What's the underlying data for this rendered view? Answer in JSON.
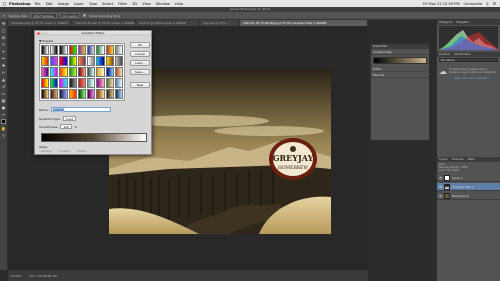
{
  "menubar": {
    "app": "Photoshop",
    "items": [
      "File",
      "Edit",
      "Image",
      "Layer",
      "Type",
      "Select",
      "Filter",
      "3D",
      "View",
      "Window",
      "Help"
    ],
    "time": "Fri May 22 12:09 PM",
    "user": "Cartophile"
  },
  "window": {
    "title": "Adobe Photoshop CC 2014"
  },
  "options": {
    "sample_label": "Sample Size:",
    "sample_value": "Point Sample",
    "layer_value": "All Layers",
    "show_ring": "Show Sampling Ring"
  },
  "doc_tabs": [
    "Yellowstone@ @ 33.3% (Layer 1, RGB/8)",
    "2014-03-15.psb @ 33.3% (Layer 1, RGB/8)",
    "Layer 5 @ 100% (Layer 2, RGB/8)",
    "logo.psd @ 33% ...",
    "2014-01-30 13.09.08.jpg @ 33.3% (Gradient Map 1, RGB/8)"
  ],
  "status": {
    "zoom": "33.33%",
    "doc": "Doc: 14.1M/28.7M"
  },
  "dialog": {
    "title": "Gradient Editor",
    "presets_label": "Presets",
    "buttons": {
      "ok": "OK",
      "cancel": "Cancel",
      "load": "Load...",
      "save": "Save...",
      "new": "New"
    },
    "name_label": "Name:",
    "name_value": "Custom",
    "type_label": "Gradient Type:",
    "type_value": "Solid",
    "smooth_label": "Smoothness:",
    "smooth_value": "100",
    "smooth_unit": "%",
    "stops_label": "Stops",
    "stops": {
      "opacity": "Opacity:",
      "location": "Location:",
      "delete": "Delete",
      "color": "Color:"
    },
    "preset_gradients": [
      [
        "#000000",
        "#ffffff"
      ],
      [
        "#ffffff",
        "#000000"
      ],
      [
        "#000000",
        "#ffffff"
      ],
      [
        "#ff0000",
        "#00ff00"
      ],
      [
        "#7a3a9a",
        "#f0c040"
      ],
      [
        "#1e3c8c",
        "#e0e0e0"
      ],
      [
        "#1f7a3a",
        "#ffffff"
      ],
      [
        "#c03030",
        "#f0e030"
      ],
      [
        "#808080",
        "#ffffff"
      ],
      [
        "#ffcc00",
        "#cc3300"
      ],
      [
        "#3355ff",
        "#ff33cc"
      ],
      [
        "#ff0000",
        "#0000ff"
      ],
      [
        "#008000",
        "#ffff00"
      ],
      [
        "#ff8c00",
        "#663399"
      ],
      [
        "#ffffff",
        "#808080"
      ],
      [
        "#00bfff",
        "#00008b"
      ],
      [
        "#ffd700",
        "#8b4513"
      ],
      [
        "#c0c0c0",
        "#404040"
      ],
      [
        "#ff69b4",
        "#4b0082"
      ],
      [
        "#00ffff",
        "#ff00ff"
      ],
      [
        "#ff4500",
        "#ffff00"
      ],
      [
        "#228b22",
        "#adff2f"
      ],
      [
        "#800000",
        "#ffa07a"
      ],
      [
        "#2f4f4f",
        "#e0ffff"
      ],
      [
        "#daa520",
        "#fff8dc"
      ],
      [
        "#000080",
        "#87cefa"
      ],
      [
        "#a0522d",
        "#ffe4b5"
      ],
      [
        "#ff0000",
        "#ffff00"
      ],
      [
        "#00ff00",
        "#0000ff"
      ],
      [
        "#ff00ff",
        "#00ffff"
      ],
      [
        "#111111",
        "#999999"
      ],
      [
        "#b22222",
        "#fa8072"
      ],
      [
        "#5f9ea0",
        "#f0fff0"
      ],
      [
        "#8b008b",
        "#ffb6c1"
      ],
      [
        "#556b2f",
        "#f5deb3"
      ],
      [
        "#4682b4",
        "#ffffff"
      ],
      [
        "#000000",
        "#ffd27f"
      ],
      [
        "#3c1a0a",
        "#d9b36b"
      ],
      [
        "#1a1a3c",
        "#a0a0ff"
      ],
      [
        "#ffb000",
        "#ff3000"
      ],
      [
        "#004000",
        "#80ff80"
      ],
      [
        "#400040",
        "#ff80ff"
      ],
      [
        "#804000",
        "#ffe0a0"
      ],
      [
        "#202020",
        "#e0c080"
      ],
      [
        "#0a2a4a",
        "#c0e0ff"
      ]
    ]
  },
  "adjustments": {
    "tab": "Properties",
    "title": "Gradient Map",
    "dither": "Dither",
    "reverse": "Reverse"
  },
  "right_dock": {
    "hist_tabs": [
      "Histogram",
      "Navigator"
    ],
    "lib_tabs": [
      "Libraries",
      "Adjustments"
    ],
    "lib_select": "My Library",
    "lib_message": "To start using Creative Cloud Libraries, sign in with your Adobe ID.",
    "lib_link": "Learn more about Libraries",
    "layers_tabs": [
      "Layers",
      "Channels",
      "Paths"
    ],
    "layers_controls": {
      "kind": "Kind",
      "mode": "Normal",
      "opacity": "Opacity: 100%",
      "fill": "Fill: 100%",
      "lock": "Lock:"
    },
    "layers": [
      {
        "name": "Layer 1"
      },
      {
        "name": "Gradient Map 1"
      },
      {
        "name": "Background"
      }
    ]
  },
  "logo": {
    "top": "GREYJAY",
    "bottom": "HOMEBREW"
  }
}
